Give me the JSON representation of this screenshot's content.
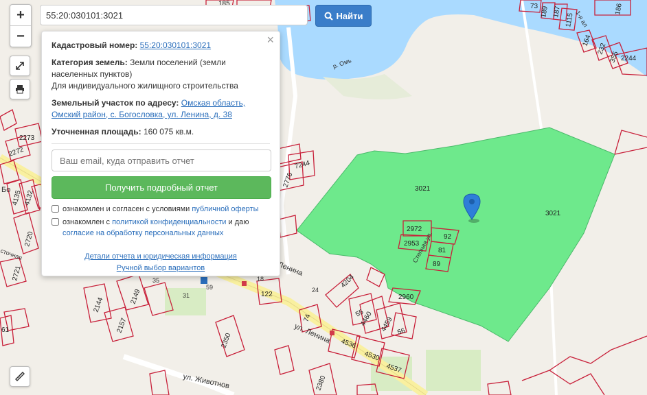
{
  "search": {
    "value": "55:20:030101:3021",
    "button_label": "Найти"
  },
  "zoom": {
    "in_label": "+",
    "out_label": "−"
  },
  "popup": {
    "close_label": "×",
    "cadastral_label": "Кадастровый номер:",
    "cadastral_value": "55:20:030101:3021",
    "category_label": "Категория земель:",
    "category_value_1": "Земли поселений (земли",
    "category_value_2": "населенных пунктов)",
    "category_usage": "Для индивидуального жилищного строительства",
    "address_label": "Земельный участок по адресу:",
    "address_value_1": "Омская область,",
    "address_value_2": "Омский район, с. Богословка, ул. Ленина, д. 38",
    "area_label": "Уточненная площадь:",
    "area_value": "160 075 кв.м.",
    "email_placeholder": "Ваш email, куда отправить отчет",
    "report_button": "Получить подробный отчет",
    "agree1_text": "ознакомлен и согласен с условиями",
    "agree1_link": "публичной оферты",
    "agree2_text": "ознакомлен с",
    "agree2_link1": "политикой конфиденциальности",
    "agree2_mid": "и даю",
    "agree2_link2": "согласие на обработку персональных данных",
    "details_link": "Детали отчета и юридическая информация",
    "manual_link": "Ручной выбор вариантов"
  },
  "map": {
    "river_label": "р. Омь",
    "street_lenina": "ул. Ленина",
    "street_lenina_2": "Ленина",
    "street_zhivotnov": "ул. Животнов",
    "street_stepnaya": "Степная ул.",
    "street_1ya": "1-я ал",
    "street_vostochnaya": "сточная",
    "village_label": "Бо",
    "selected_parcel_label_1": "3021",
    "selected_parcel_label_2": "3021",
    "marker_icon": "map-pin-icon",
    "parcels": [
      "2972",
      "92",
      "2953",
      "81",
      "89",
      "2960",
      "4204",
      "55",
      "4460",
      "4459",
      "56",
      "4536",
      "4530",
      "4537",
      "2350",
      "2157",
      "2149",
      "2144",
      "122",
      "74",
      "2380",
      "2273",
      "2272",
      "4135",
      "4132",
      "2720",
      "2721",
      "61",
      "7244",
      "2776",
      "185",
      "73",
      "189",
      "187",
      "1115",
      "164",
      "232",
      "355",
      "186",
      "2244",
      "35",
      "31",
      "24",
      "18",
      "59"
    ],
    "colors": {
      "parcel_fill": "#6ee98c",
      "parcel_border": "#c8203a",
      "river": "#aadaff",
      "background": "#f2efe9",
      "accent_button": "#3a7dc9",
      "report_button": "#5cb85c",
      "marker": "#2e7fd8"
    }
  }
}
